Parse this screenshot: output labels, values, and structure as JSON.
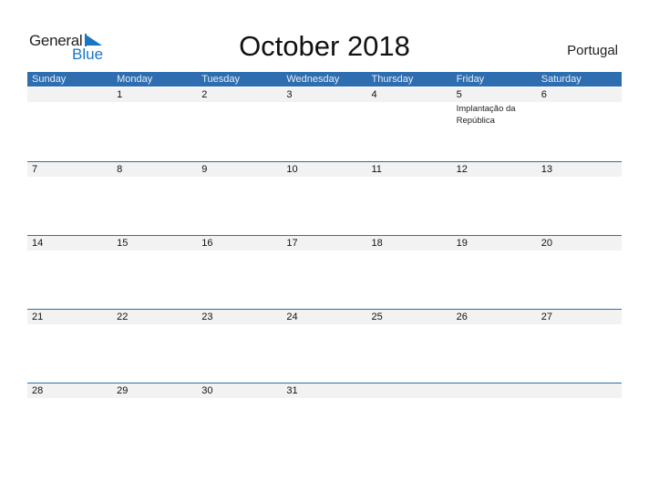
{
  "logo": {
    "line1": "General",
    "line2": "Blue",
    "icon": "triangle-flag-icon",
    "color": "#1a76c2"
  },
  "title": "October 2018",
  "country": "Portugal",
  "colors": {
    "header_bg": "#2e6eb0",
    "strip_bg": "#f2f2f2"
  },
  "weekdays": [
    "Sunday",
    "Monday",
    "Tuesday",
    "Wednesday",
    "Thursday",
    "Friday",
    "Saturday"
  ],
  "weeks": [
    [
      {
        "day": ""
      },
      {
        "day": "1"
      },
      {
        "day": "2"
      },
      {
        "day": "3"
      },
      {
        "day": "4"
      },
      {
        "day": "5",
        "event": "Implantação da República"
      },
      {
        "day": "6"
      }
    ],
    [
      {
        "day": "7"
      },
      {
        "day": "8"
      },
      {
        "day": "9"
      },
      {
        "day": "10"
      },
      {
        "day": "11"
      },
      {
        "day": "12"
      },
      {
        "day": "13"
      }
    ],
    [
      {
        "day": "14"
      },
      {
        "day": "15"
      },
      {
        "day": "16"
      },
      {
        "day": "17"
      },
      {
        "day": "18"
      },
      {
        "day": "19"
      },
      {
        "day": "20"
      }
    ],
    [
      {
        "day": "21"
      },
      {
        "day": "22"
      },
      {
        "day": "23"
      },
      {
        "day": "24"
      },
      {
        "day": "25"
      },
      {
        "day": "26"
      },
      {
        "day": "27"
      }
    ],
    [
      {
        "day": "28"
      },
      {
        "day": "29"
      },
      {
        "day": "30"
      },
      {
        "day": "31"
      },
      {
        "day": ""
      },
      {
        "day": ""
      },
      {
        "day": ""
      }
    ]
  ]
}
